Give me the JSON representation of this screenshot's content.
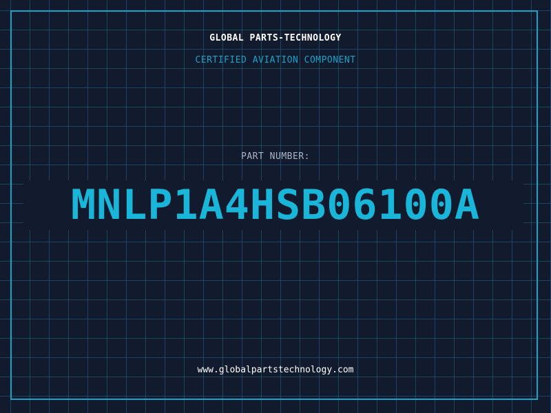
{
  "brand": "GLOBAL PARTS-TECHNOLOGY",
  "subtitle": "CERTIFIED AVIATION COMPONENT",
  "part_number_label": "PART NUMBER:",
  "part_number": "MNLP1A4HSB06100A",
  "website": "www.globalpartstechnology.com",
  "colors": {
    "background": "#121a2e",
    "accent": "#1aa3c9",
    "text": "#ffffff",
    "muted": "#a9b6c8"
  }
}
